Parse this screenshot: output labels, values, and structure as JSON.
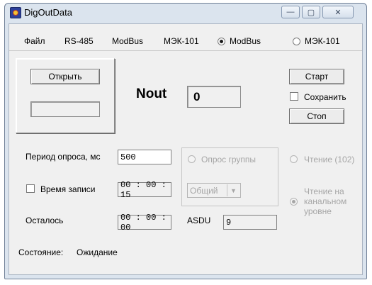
{
  "window": {
    "title": "DigOutData",
    "minimize_glyph": "—",
    "maximize_glyph": "▢",
    "close_glyph": "✕"
  },
  "menu": {
    "items": [
      "Файл",
      "RS-485",
      "ModBus",
      "МЭК-101"
    ],
    "radio_modbus": "ModBus",
    "radio_iec": "МЭК-101"
  },
  "panel": {
    "open_button": "Открыть",
    "nout_label": "Nout",
    "nout_value": "0"
  },
  "actions": {
    "start": "Старт",
    "save": "Сохранить",
    "stop": "Стоп"
  },
  "settings": {
    "period_label": "Период опроса, мс",
    "period_value": "500",
    "record_time_label": "Время записи",
    "record_time_value": "00 : 00 : 15",
    "remaining_label": "Осталось",
    "remaining_value": "00 : 00 : 00",
    "asdu_label": "ASDU",
    "asdu_value": "9"
  },
  "group_poll": {
    "label": "Опрос группы",
    "select_value": "Общий"
  },
  "read_mode": {
    "read_102": "Чтение (102)",
    "read_channel": "Чтение на канальном уровне"
  },
  "status": {
    "label": "Состояние:",
    "value": "Ожидание"
  },
  "colors": {
    "window_frame": "#dbe4ee",
    "client_bg": "#f0f0f0",
    "disabled_text": "#a6a6a6"
  },
  "icons": {
    "app": "app-icon",
    "dropdown": "chevron-down-icon"
  }
}
